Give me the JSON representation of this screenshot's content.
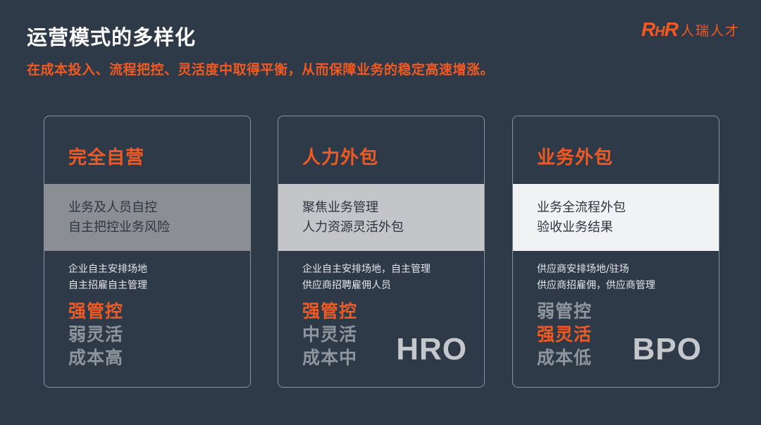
{
  "header": {
    "title": "运营模式的多样化",
    "subtitle": "在成本投入、流程把控、灵活度中取得平衡，从而保障业务的稳定高速增涨。"
  },
  "logo": {
    "mark_r": "R",
    "mark_h": "H",
    "mark_r2": "R",
    "name": "人瑞人才"
  },
  "colors": {
    "accent": "#f05a22",
    "background": "#2f3a48",
    "muted": "#8e959d"
  },
  "cards": [
    {
      "title": "完全自营",
      "band_lines": [
        "业务及人员自控",
        "自主把控业务风险"
      ],
      "details": [
        "企业自主安排场地",
        "自主招雇自主管理"
      ],
      "levels": [
        {
          "text": "强管控",
          "highlight": true
        },
        {
          "text": "弱灵活",
          "highlight": false
        },
        {
          "text": "成本高",
          "highlight": false
        }
      ],
      "model": ""
    },
    {
      "title": "人力外包",
      "band_lines": [
        "聚焦业务管理",
        "人力资源灵活外包"
      ],
      "details": [
        "企业自主安排场地，自主管理",
        "供应商招聘雇佣人员"
      ],
      "levels": [
        {
          "text": "强管控",
          "highlight": true
        },
        {
          "text": "中灵活",
          "highlight": false
        },
        {
          "text": "成本中",
          "highlight": false
        }
      ],
      "model": "HRO"
    },
    {
      "title": "业务外包",
      "band_lines": [
        "业务全流程外包",
        "验收业务结果"
      ],
      "details": [
        "供应商安排场地/驻场",
        "供应商招雇佣，供应商管理"
      ],
      "levels": [
        {
          "text": "弱管控",
          "highlight": false
        },
        {
          "text": "强灵活",
          "highlight": true
        },
        {
          "text": "成本低",
          "highlight": false
        }
      ],
      "model": "BPO"
    }
  ]
}
